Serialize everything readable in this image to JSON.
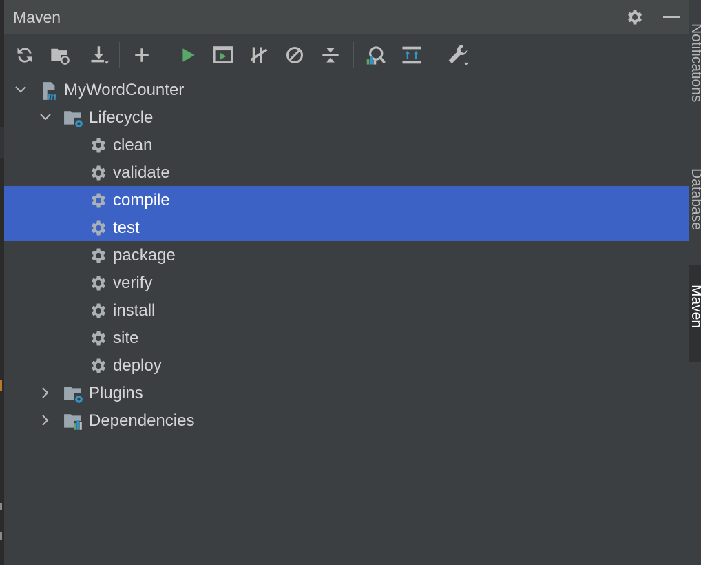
{
  "panel": {
    "title": "Maven"
  },
  "header_icons": [
    "gear-icon",
    "minimize-icon"
  ],
  "toolbar": {
    "buttons": [
      {
        "name": "reload-all-projects-button",
        "icon": "refresh-icon"
      },
      {
        "name": "generate-sources-button",
        "icon": "folder-refresh-icon"
      },
      {
        "name": "download-sources-button",
        "icon": "download-icon"
      },
      {
        "name": "add-maven-project-button",
        "icon": "plus-icon"
      },
      {
        "name": "run-maven-build-button",
        "icon": "play-icon"
      },
      {
        "name": "execute-maven-goal-button",
        "icon": "terminal-run-icon"
      },
      {
        "name": "toggle-offline-mode-button",
        "icon": "offline-icon"
      },
      {
        "name": "skip-tests-button",
        "icon": "skip-icon"
      },
      {
        "name": "collapse-all-button",
        "icon": "collapse-icon"
      },
      {
        "name": "analyze-dependencies-button",
        "icon": "analyze-icon"
      },
      {
        "name": "show-dependencies-button",
        "icon": "diagram-icon"
      },
      {
        "name": "build-tool-settings-button",
        "icon": "wrench-icon"
      }
    ]
  },
  "tree": {
    "project": {
      "label": "MyWordCounter",
      "expanded": true
    },
    "lifecycle": {
      "label": "Lifecycle",
      "expanded": true
    },
    "goals": [
      {
        "label": "clean",
        "selected": false
      },
      {
        "label": "validate",
        "selected": false
      },
      {
        "label": "compile",
        "selected": true
      },
      {
        "label": "test",
        "selected": true
      },
      {
        "label": "package",
        "selected": false
      },
      {
        "label": "verify",
        "selected": false
      },
      {
        "label": "install",
        "selected": false
      },
      {
        "label": "site",
        "selected": false
      },
      {
        "label": "deploy",
        "selected": false
      }
    ],
    "plugins": {
      "label": "Plugins",
      "expanded": false
    },
    "dependencies": {
      "label": "Dependencies",
      "expanded": false
    }
  },
  "side_tabs": [
    {
      "label": "Notifications",
      "active": false
    },
    {
      "label": "Database",
      "active": false
    },
    {
      "label": "Maven",
      "active": true
    }
  ],
  "colors": {
    "background": "#3c3f41",
    "selection": "#3d62c6",
    "run_green": "#59a869",
    "accent_blue": "#3592c4"
  }
}
